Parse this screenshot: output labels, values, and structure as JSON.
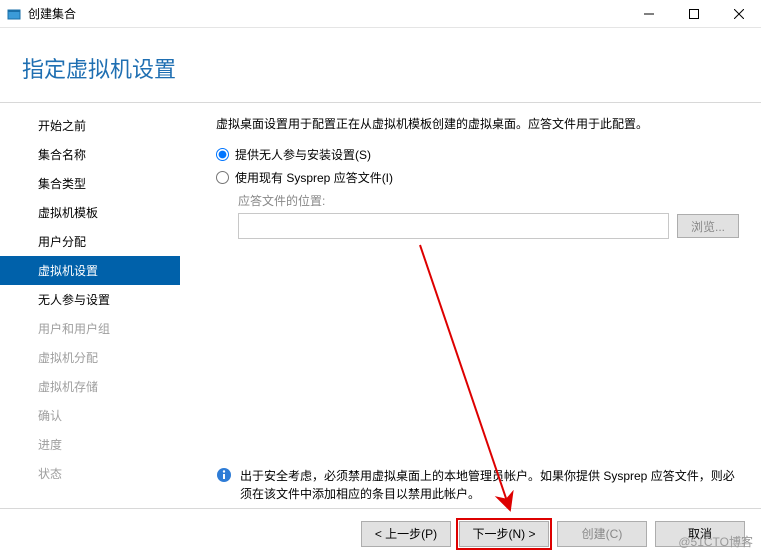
{
  "window": {
    "title": "创建集合",
    "heading": "指定虚拟机设置"
  },
  "sidebar": {
    "items": [
      {
        "label": "开始之前",
        "state": "normal"
      },
      {
        "label": "集合名称",
        "state": "normal"
      },
      {
        "label": "集合类型",
        "state": "normal"
      },
      {
        "label": "虚拟机模板",
        "state": "normal"
      },
      {
        "label": "用户分配",
        "state": "normal"
      },
      {
        "label": "虚拟机设置",
        "state": "active"
      },
      {
        "label": "无人参与设置",
        "state": "normal"
      },
      {
        "label": "用户和用户组",
        "state": "disabled"
      },
      {
        "label": "虚拟机分配",
        "state": "disabled"
      },
      {
        "label": "虚拟机存储",
        "state": "disabled"
      },
      {
        "label": "确认",
        "state": "disabled"
      },
      {
        "label": "进度",
        "state": "disabled"
      },
      {
        "label": "状态",
        "state": "disabled"
      }
    ]
  },
  "main": {
    "description": "虚拟桌面设置用于配置正在从虚拟机模板创建的虚拟桌面。应答文件用于此配置。",
    "radio1_label": "提供无人参与安装设置(S)",
    "radio2_label": "使用现有 Sysprep 应答文件(I)",
    "file_location_label": "应答文件的位置:",
    "file_location_value": "",
    "browse_label": "浏览...",
    "info_text": "出于安全考虑，必须禁用虚拟桌面上的本地管理员帐户。如果你提供 Sysprep 应答文件，则必须在该文件中添加相应的条目以禁用此帐户。"
  },
  "footer": {
    "prev": "< 上一步(P)",
    "next": "下一步(N) >",
    "create": "创建(C)",
    "cancel": "取消"
  },
  "watermark": "@51CTO博客"
}
